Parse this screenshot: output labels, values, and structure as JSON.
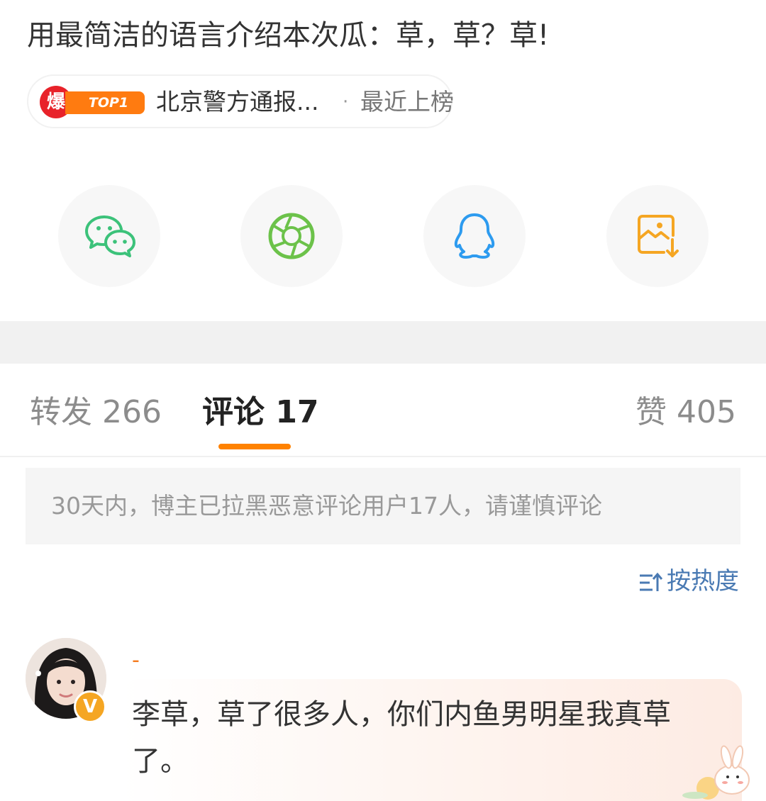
{
  "post": {
    "title": "用最简洁的语言介绍本次瓜：草，草？草!"
  },
  "hot_tag": {
    "badge_char": "爆",
    "badge_rank": "TOP1",
    "headline": "北京警方通报...",
    "separator": "·",
    "rank_note": "最近上榜"
  },
  "share": {
    "icons": [
      "wechat-icon",
      "moments-icon",
      "qq-icon",
      "save-image-icon"
    ],
    "colors": {
      "wechat": "#3cc27a",
      "moments": "#6cc24a",
      "qq": "#2d9bef",
      "save": "#f5a623"
    }
  },
  "tabs": {
    "forward": "转发 266",
    "comment": "评论 17",
    "like": "赞 405",
    "active_color": "#ff8200"
  },
  "notice": {
    "text": "30天内，博主已拉黑恶意评论用户17人，请谨慎评论"
  },
  "sort": {
    "label": "按热度",
    "icon": "sort-icon"
  },
  "comment": {
    "username": "-",
    "verified_mark": "V",
    "text": "李草，草了很多人，你们内鱼男明星我真草了。"
  }
}
